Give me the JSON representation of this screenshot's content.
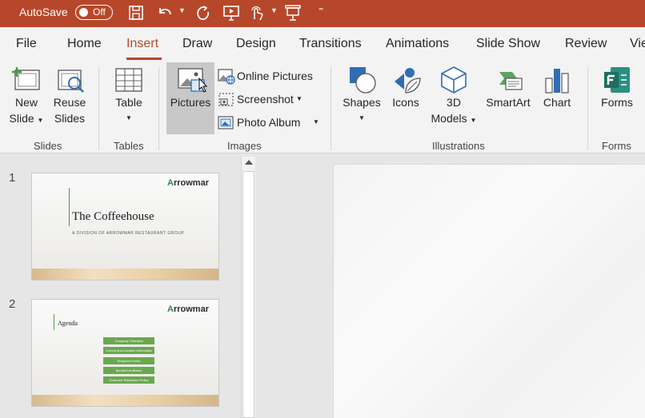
{
  "titlebar": {
    "autosave_label": "AutoSave",
    "autosave_state": "Off",
    "color": "#b7472a"
  },
  "tabs": [
    {
      "label": "File"
    },
    {
      "label": "Home"
    },
    {
      "label": "Insert",
      "active": true
    },
    {
      "label": "Draw"
    },
    {
      "label": "Design"
    },
    {
      "label": "Transitions"
    },
    {
      "label": "Animations"
    },
    {
      "label": "Slide Show"
    },
    {
      "label": "Review"
    },
    {
      "label": "Vie"
    }
  ],
  "ribbon": {
    "slides": {
      "new_slide_1": "New",
      "new_slide_2": "Slide",
      "reuse_1": "Reuse",
      "reuse_2": "Slides",
      "group": "Slides"
    },
    "tables": {
      "table": "Table",
      "group": "Tables"
    },
    "images": {
      "pictures": "Pictures",
      "online_pictures": "Online Pictures",
      "screenshot": "Screenshot",
      "photo_album": "Photo Album",
      "group": "Images"
    },
    "illustrations": {
      "shapes": "Shapes",
      "icons": "Icons",
      "models_1": "3D",
      "models_2": "Models",
      "smartart": "SmartArt",
      "chart": "Chart",
      "group": "Illustrations"
    },
    "forms": {
      "forms": "Forms",
      "group": "Forms"
    }
  },
  "slides": [
    {
      "number": "1",
      "logo": "rrowmar",
      "title": "The Coffeehouse",
      "subtitle": "A DIVISION OF ARROWMAR RESTAURANT GROUP"
    },
    {
      "number": "2",
      "logo": "rrowmar",
      "title": "Agenda",
      "items": [
        "Company Overview",
        "Current and Location Information",
        "Required Forms",
        "Benefit Enrollment",
        "Customer Resolution Policy"
      ]
    }
  ]
}
